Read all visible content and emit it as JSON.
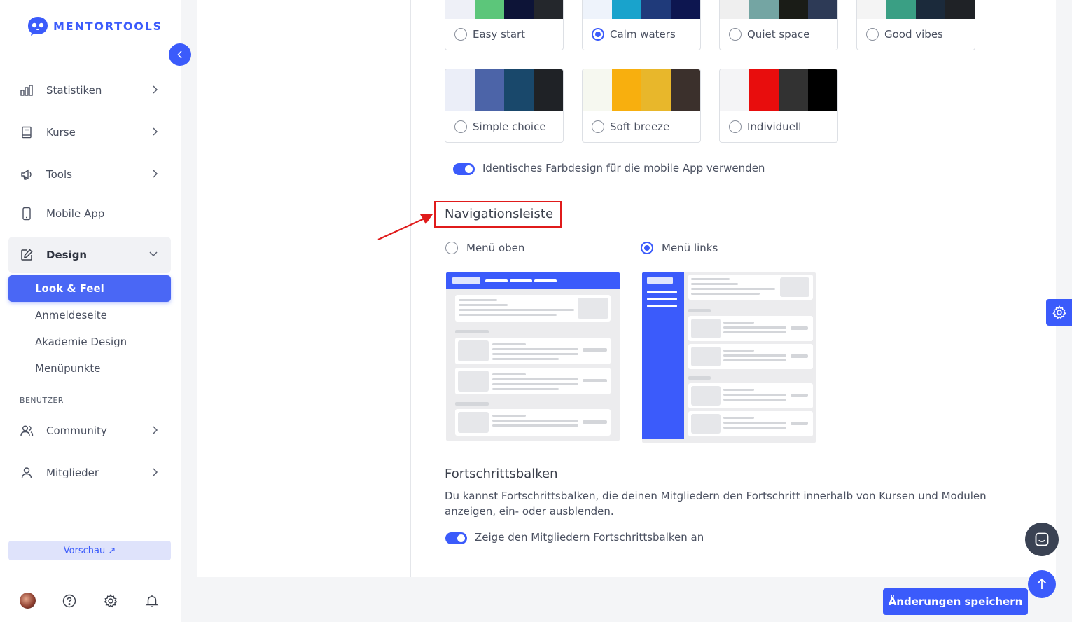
{
  "brand": {
    "name": "MENTORTOOLS",
    "accent": "#3b5bfb"
  },
  "sidebar": {
    "items": [
      {
        "label": "Statistiken",
        "icon": "bar-chart-icon"
      },
      {
        "label": "Kurse",
        "icon": "book-icon"
      },
      {
        "label": "Tools",
        "icon": "megaphone-icon"
      },
      {
        "label": "Mobile App",
        "icon": "smartphone-icon"
      },
      {
        "label": "Design",
        "icon": "edit-icon",
        "expanded": true
      }
    ],
    "design_sub": [
      "Look & Feel",
      "Anmeldeseite",
      "Akademie Design",
      "Menüpunkte"
    ],
    "active_sub": "Look & Feel",
    "section_label": "BENUTZER",
    "user_items": [
      {
        "label": "Community",
        "icon": "users-icon"
      },
      {
        "label": "Mitglieder",
        "icon": "user-icon"
      }
    ],
    "preview_label": "Vorschau ↗"
  },
  "themes": [
    {
      "label": "Easy start",
      "colors": [
        "#eef0f7",
        "#5cc67a",
        "#0d1437",
        "#24272c"
      ],
      "selected": false
    },
    {
      "label": "Calm waters",
      "colors": [
        "#eef3fb",
        "#19a3cc",
        "#1f3a7a",
        "#0d1650"
      ],
      "selected": true
    },
    {
      "label": "Quiet space",
      "colors": [
        "#efefef",
        "#74a5a3",
        "#1a1c17",
        "#2d3a56"
      ],
      "selected": false
    },
    {
      "label": "Good vibes",
      "colors": [
        "#f4f4f4",
        "#3a9f84",
        "#1b2a3b",
        "#1f2226"
      ],
      "selected": false
    },
    {
      "label": "Simple choice",
      "colors": [
        "#ebeef8",
        "#4c64a8",
        "#19486b",
        "#1f2226"
      ],
      "selected": false
    },
    {
      "label": "Soft breeze",
      "colors": [
        "#f6f8f0",
        "#f8af0e",
        "#e8b72b",
        "#3b302c"
      ],
      "selected": false
    },
    {
      "label": "Individuell",
      "colors": [
        "#f4f4f6",
        "#e80d0d",
        "#323232",
        "#000000"
      ],
      "selected": false
    }
  ],
  "mobile_toggle": {
    "label": "Identisches Farbdesign für die mobile App verwenden",
    "on": true
  },
  "navigation": {
    "title": "Navigationsleiste",
    "options": [
      {
        "label": "Menü oben",
        "selected": false
      },
      {
        "label": "Menü links",
        "selected": true
      }
    ]
  },
  "progress": {
    "title": "Fortschrittsbalken",
    "description": "Du kannst Fortschrittsbalken, die deinen Mitgliedern den Fortschritt innerhalb von Kursen und Modulen anzeigen, ein- oder ausblenden.",
    "toggle_label": "Zeige den Mitgliedern Fortschrittsbalken an",
    "on": true
  },
  "save_label": "Änderungen speichern"
}
